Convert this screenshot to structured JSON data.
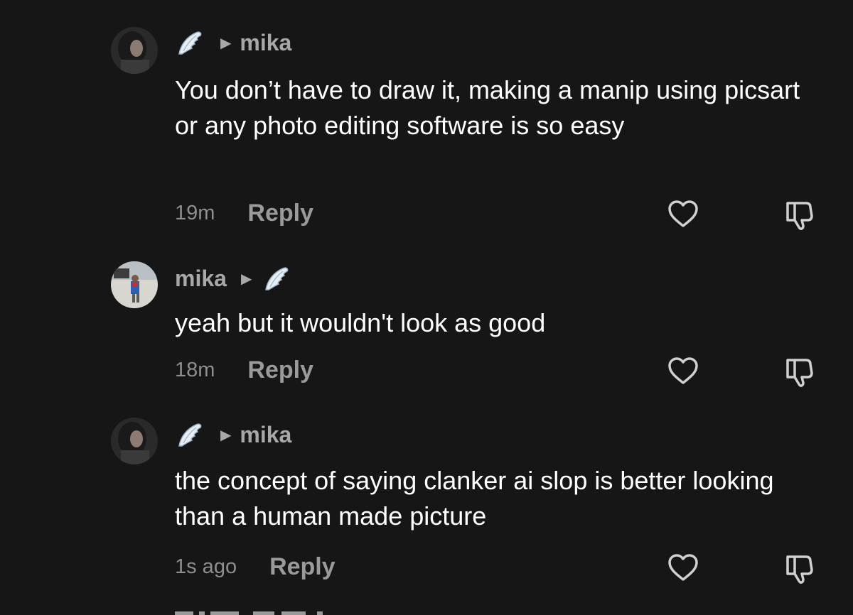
{
  "comments": [
    {
      "author": "mika",
      "badge": "wing-icon",
      "header_layout": "badge-caret-name",
      "text": "You don’t have to draw it, making a manip using picsart or any photo editing software is so easy",
      "time": "19m",
      "reply_label": "Reply"
    },
    {
      "author": "mika",
      "badge": "wing-icon",
      "header_layout": "name-caret-badge",
      "text": "yeah but it wouldn't look as good",
      "time": "18m",
      "reply_label": "Reply"
    },
    {
      "author": "mika",
      "badge": "wing-icon",
      "header_layout": "badge-caret-name",
      "text": "the concept of saying clanker ai slop is better looking than a human made picture",
      "time": "1s ago",
      "reply_label": "Reply"
    }
  ],
  "icons": {
    "like": "heart-icon",
    "dislike": "thumbs-down-icon",
    "caret": "caret-right-icon"
  },
  "colors": {
    "background": "#161616",
    "text": "#ffffff",
    "muted": "#a8a8a8"
  }
}
